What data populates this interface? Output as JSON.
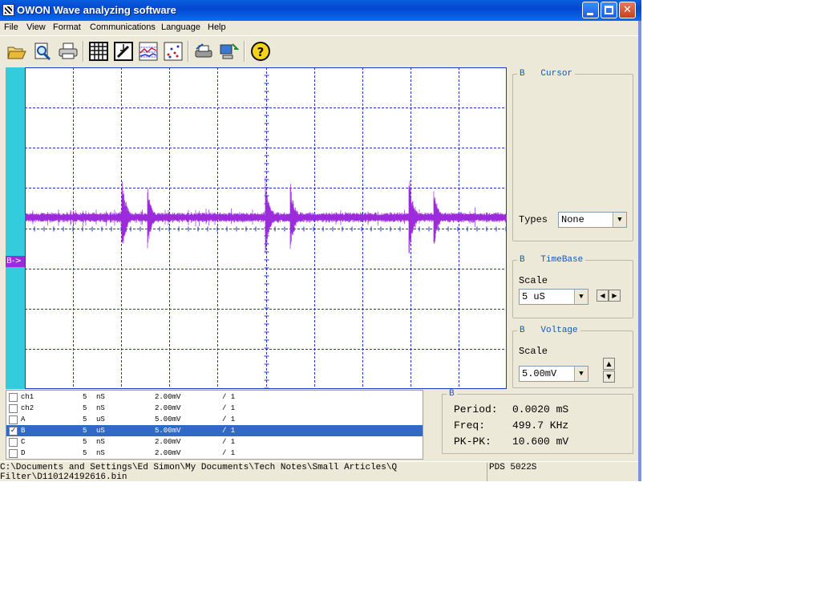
{
  "window": {
    "title": "OWON Wave analyzing software"
  },
  "menu": [
    "File",
    "View",
    "Format",
    "Communications",
    "Language",
    "Help"
  ],
  "toolbar": {
    "buttons": [
      "open-icon",
      "print-preview-icon",
      "print-icon",
      "calculator-icon",
      "edit-icon",
      "chart-icon",
      "scatter-icon",
      "printer-settings-icon",
      "computer-icon",
      "help-icon"
    ]
  },
  "scope": {
    "channel_marker": "B->",
    "trace_color": "#9c2bdc",
    "grid_color": "#1f35c8",
    "channel_strip_color": "#33ccdd"
  },
  "cursor_panel": {
    "legend_channel": "B",
    "legend_title": "Cursor",
    "types_label": "Types",
    "types_value": "None"
  },
  "timebase_panel": {
    "legend_channel": "B",
    "legend_title": "TimeBase",
    "scale_label": "Scale",
    "scale_value": "5  uS"
  },
  "voltage_panel": {
    "legend_channel": "B",
    "legend_title": "Voltage",
    "scale_label": "Scale",
    "scale_value": "5.00mV"
  },
  "channels": [
    {
      "name": "ch1",
      "time": "5",
      "unit": "nS",
      "volt": "2.00mV",
      "ratio": "/ 1",
      "checked": false,
      "selected": false
    },
    {
      "name": "ch2",
      "time": "5",
      "unit": "nS",
      "volt": "2.00mV",
      "ratio": "/ 1",
      "checked": false,
      "selected": false
    },
    {
      "name": "A",
      "time": "5",
      "unit": "uS",
      "volt": "5.00mV",
      "ratio": "/ 1",
      "checked": false,
      "selected": false
    },
    {
      "name": "B",
      "time": "5",
      "unit": "uS",
      "volt": "5.00mV",
      "ratio": "/ 1",
      "checked": true,
      "selected": true
    },
    {
      "name": "C",
      "time": "5",
      "unit": "nS",
      "volt": "2.00mV",
      "ratio": "/ 1",
      "checked": false,
      "selected": false
    },
    {
      "name": "D",
      "time": "5",
      "unit": "nS",
      "volt": "2.00mV",
      "ratio": "/ 1",
      "checked": false,
      "selected": false
    }
  ],
  "measurements": {
    "legend_channel": "B",
    "period_label": "Period:",
    "period_value": "0.0020 mS",
    "freq_label": "Freq:",
    "freq_value": "499.7 KHz",
    "pkpk_label": "PK-PK:",
    "pkpk_value": "10.600 mV"
  },
  "status": {
    "path_line1": "C:\\Documents and Settings\\Ed Simon\\My Documents\\Tech Notes\\Small Articles\\Q",
    "path_line2": "Filter\\D110124192616.bin",
    "model": "PDS 5022S"
  }
}
